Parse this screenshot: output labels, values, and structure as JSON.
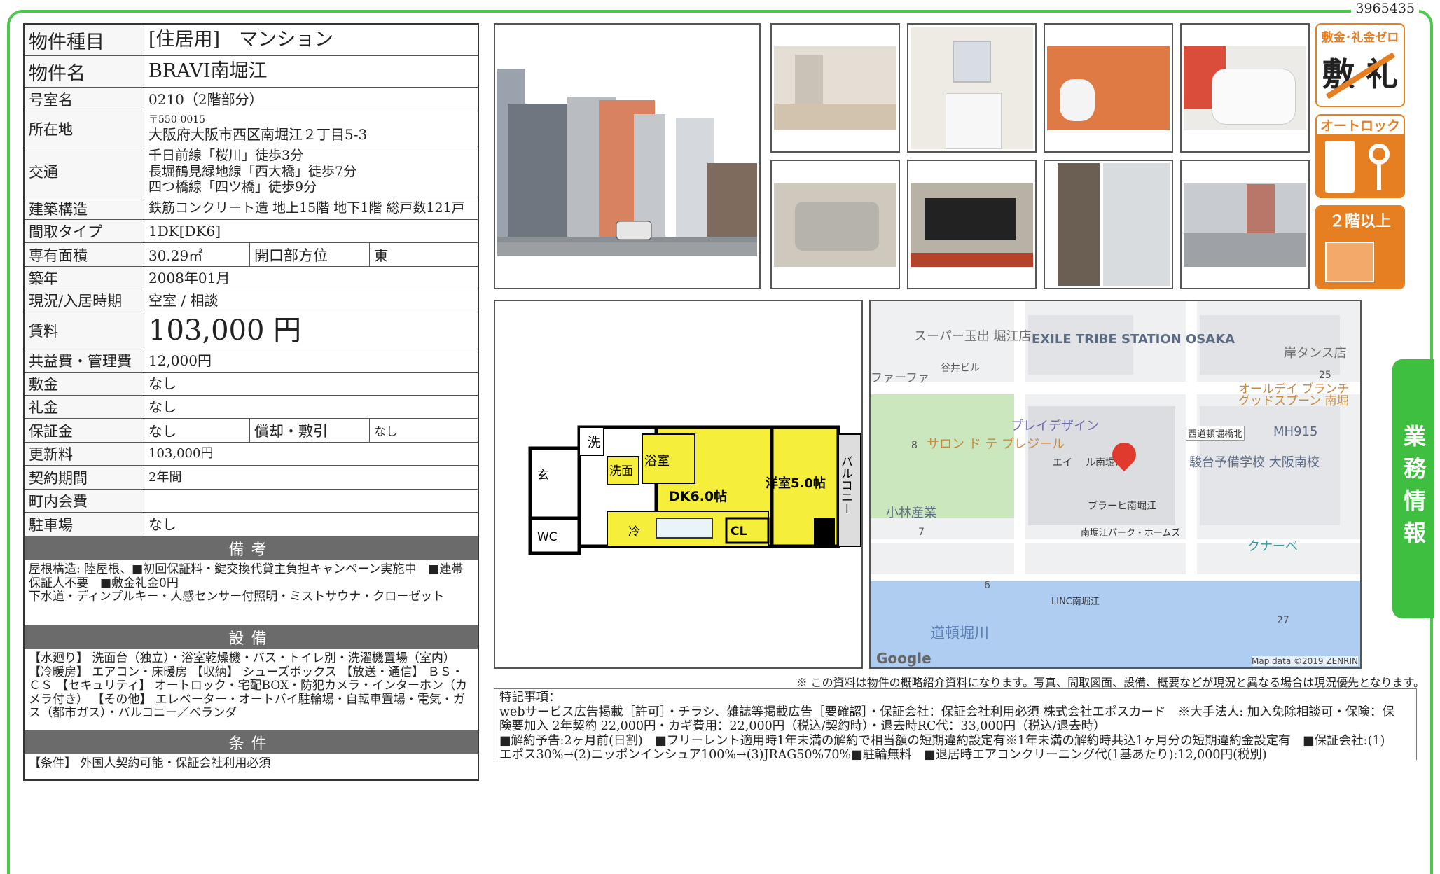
{
  "doc_number": "3965435",
  "property": {
    "rows": [
      {
        "label": "物件種目",
        "value": "[住居用]　マンション"
      },
      {
        "label": "物件名",
        "value": "BRAVI南堀江"
      },
      {
        "label": "号室名",
        "value": "0210（2階部分）"
      },
      {
        "label": "所在地",
        "zip": "〒550-0015",
        "value": "大阪府大阪市西区南堀江２丁目5-3"
      },
      {
        "label": "交通",
        "lines": [
          "千日前線「桜川」徒歩3分",
          "長堀鶴見緑地線「西大橋」徒歩7分",
          "四つ橋線「四ツ橋」徒歩9分"
        ]
      },
      {
        "label": "建築構造",
        "value": "鉄筋コンクリート造 地上15階 地下1階 総戸数121戸"
      },
      {
        "label": "間取タイプ",
        "value": "1DK[DK6]"
      },
      {
        "label": "専有面積",
        "value": "30.29㎡",
        "label2": "開口部方位",
        "value2": "東"
      },
      {
        "label": "築年",
        "value": "2008年01月"
      },
      {
        "label": "現況/入居時期",
        "value": "空室 / 相談"
      },
      {
        "label": "賃料",
        "value": "103,000 円"
      },
      {
        "label": "共益費・管理費",
        "value": "12,000円"
      },
      {
        "label": "敷金",
        "value": "なし"
      },
      {
        "label": "礼金",
        "value": "なし"
      },
      {
        "label": "保証金",
        "value": "なし",
        "label2": "償却・敷引",
        "value2": "なし"
      },
      {
        "label": "更新料",
        "value": "103,000円"
      },
      {
        "label": "契約期間",
        "value": "2年間"
      },
      {
        "label": "町内会費",
        "value": ""
      },
      {
        "label": "駐車場",
        "value": "なし"
      }
    ],
    "remarks_title": "備考",
    "remarks": "屋根構造: 陸屋根、■初回保証料・鍵交換代貸主負担キャンペーン実施中　■連帯保証人不要　■敷金礼金0円\n下水道・ディンプルキー・人感センサー付照明・ミストサウナ・クローゼット",
    "equipment_title": "設備",
    "equipment": "【水廻り】 洗面台（独立）・浴室乾燥機・バス・トイレ別・洗濯機置場（室内） 【冷暖房】 エアコン・床暖房 【収納】 シューズボックス 【放送・通信】 ＢＳ・ＣＳ 【セキュリティ】 オートロック・宅配BOX・防犯カメラ・インターホン（カメラ付き） 【その他】 エレベーター・オートバイ駐輪場・自転車置場・電気・ガス（都市ガス）・バルコニー／ベランダ",
    "conditions_title": "条件",
    "conditions": "【条件】 外国人契約可能・保証会社利用必須"
  },
  "badges": [
    {
      "title": "敷金･礼金ゼロ",
      "body": "敷 礼"
    },
    {
      "title": "オートロック",
      "body": ""
    },
    {
      "title": "２階以上",
      "body": ""
    }
  ],
  "floor_plan": {
    "rooms": [
      "洗",
      "洗面",
      "浴室",
      "玄",
      "DK6.0帖",
      "洋室5.0帖",
      "バルコニー",
      "WC",
      "冷",
      "CL"
    ]
  },
  "map": {
    "labels": [
      "スーパー玉出 堀江店",
      "EXILE TRIBE STATION OSAKA",
      "岸タンス店",
      "ファーファ",
      "谷井ビル",
      "25",
      "オールデイ ブランチ グッドスプーン 南堀",
      "プレイデザイン",
      "西道頓堀橋北",
      "MH915",
      "8",
      "サロン ド テ ブレジール",
      "エイ",
      "ル南堀江",
      "駿台予備学校 大阪南校",
      "小林産業",
      "ブラーヒ南堀江",
      "7",
      "南堀江パーク・ホームズ",
      "クナーベ",
      "6",
      "LINC南堀江",
      "道頓堀川",
      "27"
    ],
    "logo": "Google",
    "copyright": "Map data ©2019 ZENRIN"
  },
  "note_line": "※ この資料は物件の概略紹介資料になります。写真、間取図面、設備、概要などが現況と異なる場合は現況優先となります。",
  "tokki": {
    "title": "特記事項：",
    "lines": [
      "webサービス広告掲載［許可］・チラシ、雑誌等掲載広告［要確認］・保証会社：保証会社利用必須 株式会社エポスカード　※大手法人: 加入免除相談可・保険：保",
      "険要加入 2年契約 22,000円・カギ費用：22,000円（税込/契約時）・退去時RC代：33,000円（税込/退去時）",
      "■解約予告:2ヶ月前(日割)　■フリーレント適用時1年未満の解約で相当額の短期違約設定有※1年未満の解約時共込1ヶ月分の短期違約金設定有　■保証会社:(1)",
      "エポス30%→(2)ニッポンインシュア100%→(3)JRAG50%70%■駐輪無料　■退居時エアコンクリーニング代(1基あたり):12,000円(税別)"
    ]
  },
  "side_tab": "業務情報",
  "colors": {
    "frame": "#4cc64c",
    "badge": "#e67e22",
    "plan_yellow": "#f5ee3a",
    "river": "#aecdf0"
  }
}
